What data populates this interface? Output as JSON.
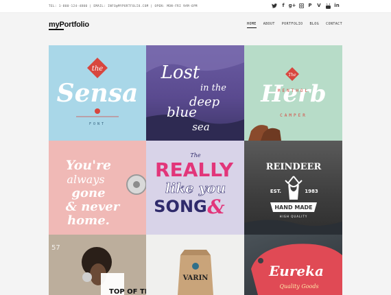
{
  "topbar": {
    "info": "TEL: 1-800-124-4800 | EMAIL: INFO@MYPORTFOLIO.COM | OPEN: MON-FRI 9AM-6PM",
    "social_icons": [
      "twitter-icon",
      "facebook-icon",
      "google-plus-icon",
      "instagram-icon",
      "pinterest-icon",
      "vimeo-icon",
      "youtube-icon",
      "linkedin-icon"
    ]
  },
  "header": {
    "logo_part1": "my",
    "logo_part2": "Portfolio",
    "nav": [
      "HOME",
      "ABOUT",
      "PORTFOLIO",
      "BLOG",
      "CONTACT"
    ],
    "active_nav": "HOME"
  },
  "portfolio": {
    "tiles": [
      {
        "line1": "the",
        "line2": "Sensa",
        "line3": "FONT"
      },
      {
        "line1": "Lost",
        "line2": "in the",
        "line3": "deep",
        "line4": "blue",
        "line5": "sea"
      },
      {
        "line1": "The",
        "line2": "Herb",
        "line3": "MENTHOL",
        "line4": "CAMPER"
      },
      {
        "line1": "You're",
        "line2": "always",
        "line3": "gone",
        "line4": "& never",
        "line5": "home."
      },
      {
        "line1": "The",
        "line2": "REALLY",
        "line3": "like you",
        "line4": "SONG",
        "line5": "&"
      },
      {
        "line1": "REINDEER",
        "line2": "EST.",
        "line3": "1983",
        "line4": "HAND MADE",
        "line5": "HIGH QUALITY"
      },
      {
        "line1": "57",
        "line2": "TOP OF THE"
      },
      {
        "line1": "VARIN"
      },
      {
        "line1": "Eureka",
        "line2": "Quality Goods"
      }
    ]
  },
  "colors": {
    "accent": "#111111",
    "tile_blue": "#a9d7e8",
    "tile_purple": "#5a4a8f",
    "tile_green": "#b7dcc8",
    "tile_pink": "#f0b9b6",
    "tile_lavender": "#d8d3e8",
    "tile_dark": "#3d3d3d",
    "red_badge": "#d8463e"
  }
}
